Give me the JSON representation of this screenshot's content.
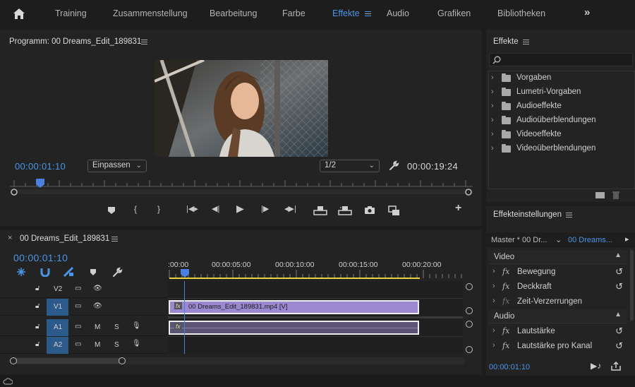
{
  "topnav": {
    "items": [
      "Training",
      "Zusammenstellung",
      "Bearbeitung",
      "Farbe",
      "Effekte",
      "Audio",
      "Grafiken",
      "Bibliotheken"
    ],
    "active": "Effekte"
  },
  "program_monitor": {
    "title": "Programm: 00 Dreams_Edit_189831",
    "current_time": "00:00:01:10",
    "zoom": "Einpassen",
    "resolution": "1/2",
    "duration": "00:00:19:24"
  },
  "effects_panel": {
    "title": "Effekte",
    "search_placeholder": "",
    "items": [
      "Vorgaben",
      "Lumetri-Vorgaben",
      "Audioeffekte",
      "Audioüberblendungen",
      "Videoeffekte",
      "Videoüberblendungen"
    ]
  },
  "effect_controls": {
    "title": "Effekteinstellungen",
    "master": "Master * 00 Dr...",
    "clip": "00 Dreams...",
    "video_header": "Video",
    "video_items": [
      "Bewegung",
      "Deckkraft",
      "Zeit-Verzerrungen"
    ],
    "audio_header": "Audio",
    "audio_items": [
      "Lautstärke",
      "Lautstärke pro Kanal"
    ],
    "time": "00:00:01:10"
  },
  "timeline": {
    "title": "00 Dreams_Edit_189831",
    "current_time": "00:00:01:10",
    "ruler": [
      ":00:00",
      "00:00:05:00",
      "00:00:10:00",
      "00:00:15:00",
      "00:00:20:00"
    ],
    "tracks": [
      {
        "name": "V2",
        "kind": "video"
      },
      {
        "name": "V1",
        "kind": "video"
      },
      {
        "name": "A1",
        "kind": "audio"
      },
      {
        "name": "A2",
        "kind": "audio"
      }
    ],
    "mute": "M",
    "solo": "S",
    "clip_video_label": "00 Dreams_Edit_189831.mp4 [V]",
    "clip_fx_badge": "fx"
  },
  "colors": {
    "accent": "#4a95e6",
    "video_clip": "#9a88d0",
    "audio_clip": "#5b5475",
    "playhead": "#4a80e0",
    "work_area": "#e8d43a"
  }
}
